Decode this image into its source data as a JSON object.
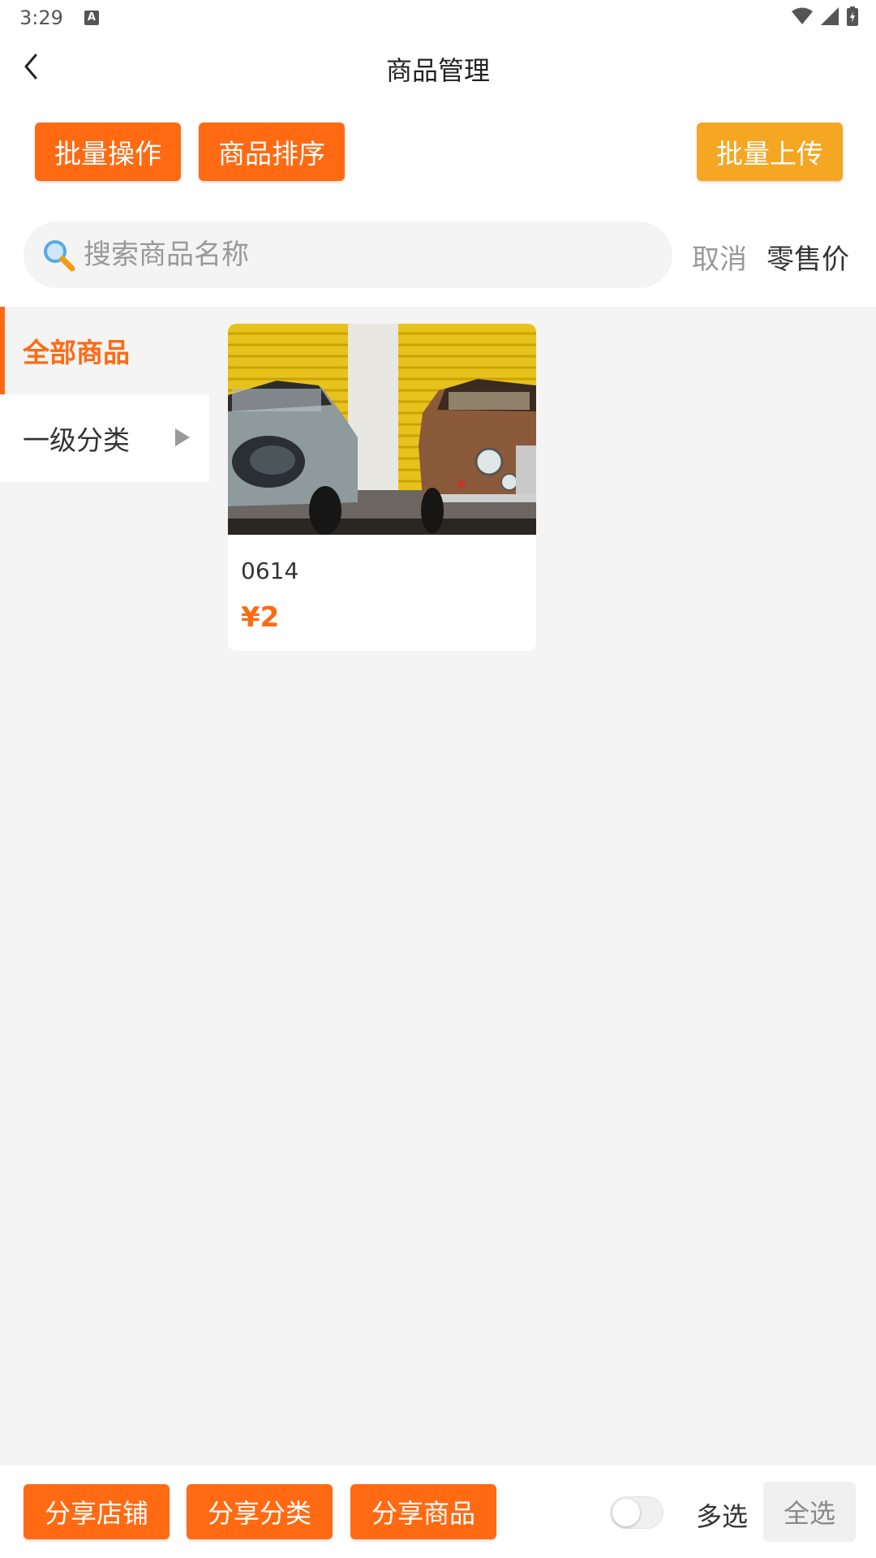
{
  "status_bar": {
    "time": "3:29",
    "notification_icon": "A",
    "icons": [
      "wifi-icon",
      "signal-icon",
      "battery-icon"
    ]
  },
  "header": {
    "title": "商品管理",
    "back_icon": "chevron-left-icon"
  },
  "actions": {
    "batch_operation": "批量操作",
    "product_sort": "商品排序",
    "batch_upload": "批量上传"
  },
  "search": {
    "value": "",
    "placeholder": "搜索商品名称",
    "cancel_label": "取消",
    "price_label": "零售价"
  },
  "sidebar": {
    "items": [
      {
        "label": "全部商品",
        "active": true
      },
      {
        "label": "一级分类",
        "active": false,
        "has_arrow": true
      }
    ]
  },
  "products": [
    {
      "name": "0614",
      "price": "¥2",
      "image": "two-vintage-cars-yellow-garage"
    }
  ],
  "bottom_bar": {
    "share_shop": "分享店铺",
    "share_category": "分享分类",
    "share_product": "分享商品",
    "multi_select": "多选",
    "multi_select_on": false,
    "select_all": "全选"
  },
  "colors": {
    "primary_orange": "#ff6a13",
    "upload_orange": "#f5a623",
    "background": "#f4f4f4"
  }
}
